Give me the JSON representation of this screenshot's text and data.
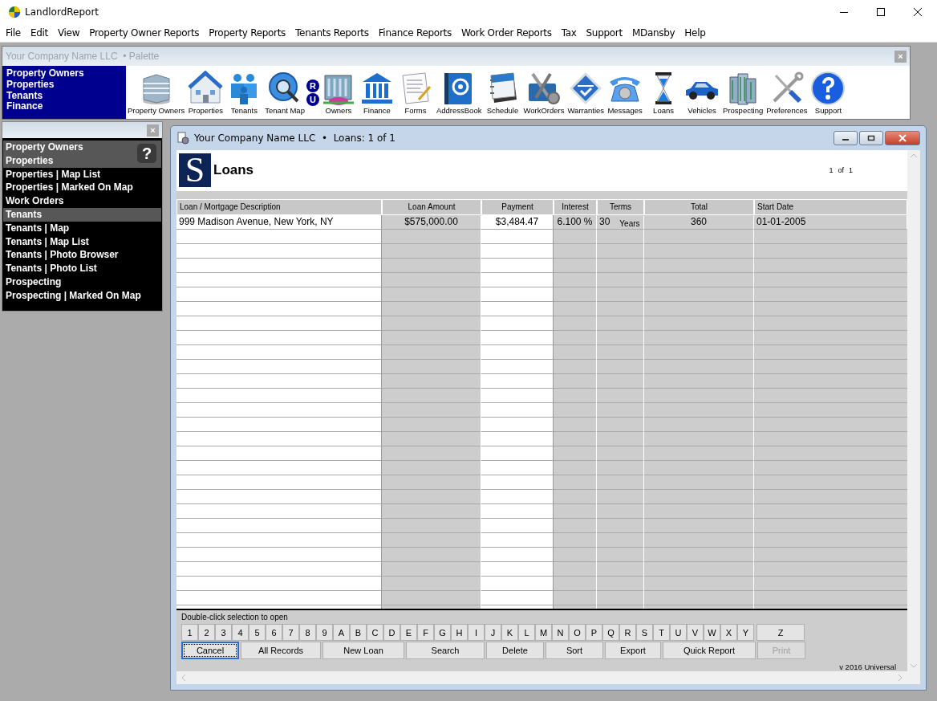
{
  "app": {
    "title": "LandlordReport"
  },
  "menu": [
    "File",
    "Edit",
    "View",
    "Property Owner Reports",
    "Property Reports",
    "Tenants Reports",
    "Finance Reports",
    "Work Order Reports",
    "Tax",
    "Support",
    "MDansby",
    "Help"
  ],
  "palette": {
    "title": "Your Company Name LLC  • Palette",
    "close": "×",
    "quick_links": [
      "Property Owners",
      "Properties",
      "Tenants",
      "Finance"
    ],
    "ru_badges": [
      "R",
      "U"
    ],
    "tools": [
      {
        "label": "Property Owners"
      },
      {
        "label": "Properties"
      },
      {
        "label": "Tenants"
      },
      {
        "label": "Tenant Map"
      },
      {
        "label": "Owners"
      },
      {
        "label": "Finance"
      },
      {
        "label": "Forms"
      },
      {
        "label": "AddressBook"
      },
      {
        "label": "Schedule"
      },
      {
        "label": "WorkOrders"
      },
      {
        "label": "Warranties"
      },
      {
        "label": "Messages"
      },
      {
        "label": "Loans"
      },
      {
        "label": "Vehicles"
      },
      {
        "label": "Prospecting"
      },
      {
        "label": "Preferences"
      },
      {
        "label": "Support"
      }
    ]
  },
  "side_panel": {
    "close": "×",
    "help": "?",
    "items": [
      {
        "label": "Property Owners",
        "kind": "section"
      },
      {
        "label": "Properties",
        "kind": "section"
      },
      {
        "label": "Properties | Map List",
        "kind": "link"
      },
      {
        "label": "Properties | Marked On Map",
        "kind": "link"
      },
      {
        "label": "Work Orders",
        "kind": "link"
      },
      {
        "label": "Tenants",
        "kind": "section"
      },
      {
        "label": "Tenants | Map",
        "kind": "link"
      },
      {
        "label": "Tenants | Map List",
        "kind": "link"
      },
      {
        "label": "Tenants | Photo Browser",
        "kind": "link"
      },
      {
        "label": "Tenants | Photo List",
        "kind": "link"
      },
      {
        "label": "Prospecting",
        "kind": "link"
      },
      {
        "label": "Prospecting | Marked On Map",
        "kind": "link"
      }
    ]
  },
  "loans_window": {
    "title": "Your Company Name LLC  •  Loans: 1 of 1",
    "logo": "S",
    "heading": "Loans",
    "pager": {
      "current": "1",
      "of": "of",
      "total": "1"
    },
    "table": {
      "columns": [
        "Loan / Mortgage Description",
        "Loan Amount",
        "Payment",
        "Interest",
        "Terms",
        "Total",
        "Start Date"
      ],
      "rows": [
        {
          "cells": [
            "999 Madison Avenue, New York, NY",
            "$575,000.00",
            "$3,484.47",
            "6.100 %",
            "30",
            "360",
            "01-01-2005"
          ],
          "terms_unit": "Years"
        }
      ]
    },
    "hint": "Double-click selection to open",
    "letters": [
      "1",
      "2",
      "3",
      "4",
      "5",
      "6",
      "7",
      "8",
      "9",
      "A",
      "B",
      "C",
      "D",
      "E",
      "F",
      "G",
      "H",
      "I",
      "J",
      "K",
      "L",
      "M",
      "N",
      "O",
      "P",
      "Q",
      "R",
      "S",
      "T",
      "U",
      "V",
      "W",
      "X",
      "Y",
      "Z"
    ],
    "actions": [
      {
        "label": "Cancel",
        "focused": true,
        "disabled": false
      },
      {
        "label": "All Records",
        "focused": false,
        "disabled": false
      },
      {
        "label": "New Loan",
        "focused": false,
        "disabled": false
      },
      {
        "label": "Search",
        "focused": false,
        "disabled": false
      },
      {
        "label": "Delete",
        "focused": false,
        "disabled": false
      },
      {
        "label": "Sort",
        "focused": false,
        "disabled": false
      },
      {
        "label": "Export",
        "focused": false,
        "disabled": false
      },
      {
        "label": "Quick Report",
        "focused": false,
        "disabled": false
      },
      {
        "label": "Print",
        "focused": false,
        "disabled": true
      }
    ],
    "version": "v 2016 Universal"
  }
}
